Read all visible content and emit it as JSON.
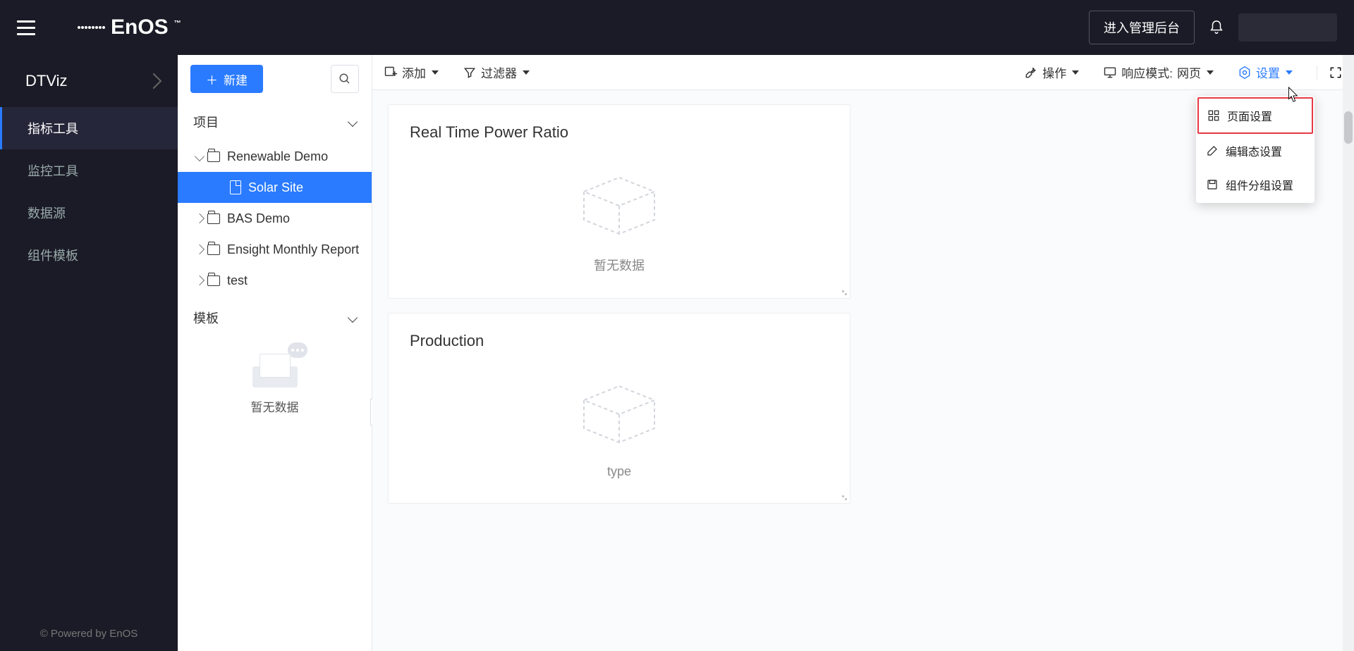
{
  "topbar": {
    "brand": "EnOS",
    "admin_button": "进入管理后台"
  },
  "sidebar": {
    "title": "DTViz",
    "items": [
      {
        "label": "指标工具",
        "active": true
      },
      {
        "label": "监控工具",
        "active": false
      },
      {
        "label": "数据源",
        "active": false
      },
      {
        "label": "组件模板",
        "active": false
      }
    ],
    "footer": "© Powered by EnOS"
  },
  "tree": {
    "new_button": "新建",
    "section_label": "项目",
    "templates_label": "模板",
    "templates_empty": "暂无数据",
    "nodes": [
      {
        "label": "Renewable Demo",
        "kind": "folder",
        "lvl": 1,
        "twist": "open"
      },
      {
        "label": "Solar Site",
        "kind": "file",
        "lvl": 2,
        "twist": "none",
        "selected": true
      },
      {
        "label": "BAS Demo",
        "kind": "folder",
        "lvl": 1,
        "twist": "closed"
      },
      {
        "label": "Ensight Monthly Report",
        "kind": "folder",
        "lvl": 1,
        "twist": "closed"
      },
      {
        "label": "test",
        "kind": "folder",
        "lvl": 1,
        "twist": "closed"
      }
    ]
  },
  "toolbar": {
    "add": "添加",
    "filter": "过滤器",
    "operation": "操作",
    "responsive_label": "响应模式:",
    "responsive_value": "网页",
    "settings": "设置"
  },
  "settings_menu": {
    "page_settings": "页面设置",
    "edit_mode_settings": "编辑态设置",
    "component_group_settings": "组件分组设置"
  },
  "cards": [
    {
      "title": "Real Time Power Ratio",
      "placeholder": "暂无数据"
    },
    {
      "title": "Production",
      "placeholder": "type"
    }
  ]
}
